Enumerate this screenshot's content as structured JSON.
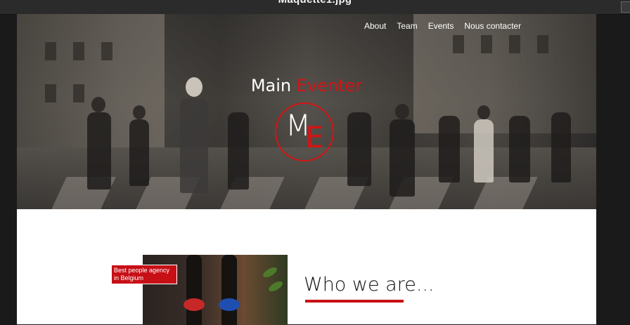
{
  "viewer": {
    "title": "Maquette1.jpg"
  },
  "nav": {
    "items": [
      "About",
      "Team",
      "Events",
      "Nous contacter"
    ]
  },
  "brand": {
    "word1": "Main",
    "word2": "Eventer",
    "logo_letter1": "M",
    "logo_letter2": "E"
  },
  "content": {
    "badge_text": "Best people agency in Belgium",
    "heading": "Who we are..."
  },
  "colors": {
    "accent": "#d31414",
    "badge": "#c70f16",
    "page_bg": "#ffffff",
    "viewer_bg": "#1a1a1a"
  }
}
